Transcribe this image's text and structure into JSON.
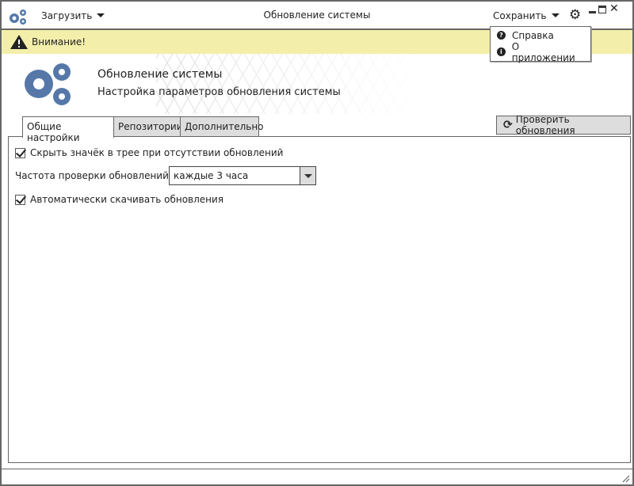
{
  "window": {
    "title": "Обновление системы"
  },
  "toolbar": {
    "load_label": "Загрузить",
    "save_label": "Сохранить"
  },
  "save_menu": {
    "items": [
      {
        "label": "Справка",
        "icon": "question-circle-icon"
      },
      {
        "label": "О приложении",
        "icon": "info-circle-icon"
      }
    ]
  },
  "alert": {
    "text": "Внимание!"
  },
  "header": {
    "title": "Обновление системы",
    "subtitle": "Настройка параметров обновления системы"
  },
  "tabs": [
    {
      "label": "Общие настройки",
      "active": true
    },
    {
      "label": "Репозитории",
      "active": false
    },
    {
      "label": "Дополнительно",
      "active": false
    }
  ],
  "check_button": {
    "label": "Проверить обновления"
  },
  "settings": {
    "hide_tray_icon": {
      "label": "Скрыть значёк в трее при отсутствии обновлений",
      "checked": true
    },
    "frequency": {
      "label": "Частота проверки обновлений",
      "value": "каждые 3 часа"
    },
    "auto_download": {
      "label": "Автоматически скачивать обновления",
      "checked": true
    }
  },
  "colors": {
    "accent": "#5578a8",
    "alert_bg": "#f3efaa"
  }
}
